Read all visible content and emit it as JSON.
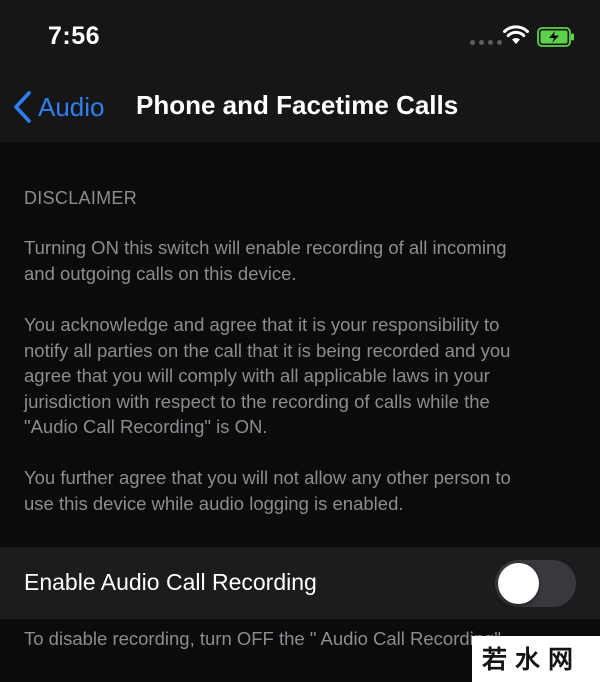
{
  "status_bar": {
    "time": "7:56",
    "icons": [
      "cellular-signal-icon",
      "wifi-icon",
      "battery-charging-icon"
    ],
    "battery_color": "#5dd24b"
  },
  "nav": {
    "back_label": "Audio",
    "title": "Phone and Facetime Calls",
    "accent_color": "#2f7ff2"
  },
  "disclaimer": {
    "header": "DISCLAIMER",
    "paragraphs": [
      "Turning ON this switch will enable recording of all incoming\nand outgoing calls on this device.",
      "You acknowledge and agree that it is your responsibility to\nnotify all parties on the call that it is being recorded and you\nagree that you will comply with all applicable laws in your\njurisdiction with respect to the recording of calls while the\n\"Audio Call Recording\" is ON.",
      "You further agree that you will not allow any other person to\nuse this device while audio logging is enabled."
    ]
  },
  "setting": {
    "label": "Enable Audio Call Recording",
    "enabled": false
  },
  "footer": {
    "note": "To disable recording, turn OFF the \" Audio Call Recording\""
  },
  "watermark": {
    "text": "若水网"
  }
}
